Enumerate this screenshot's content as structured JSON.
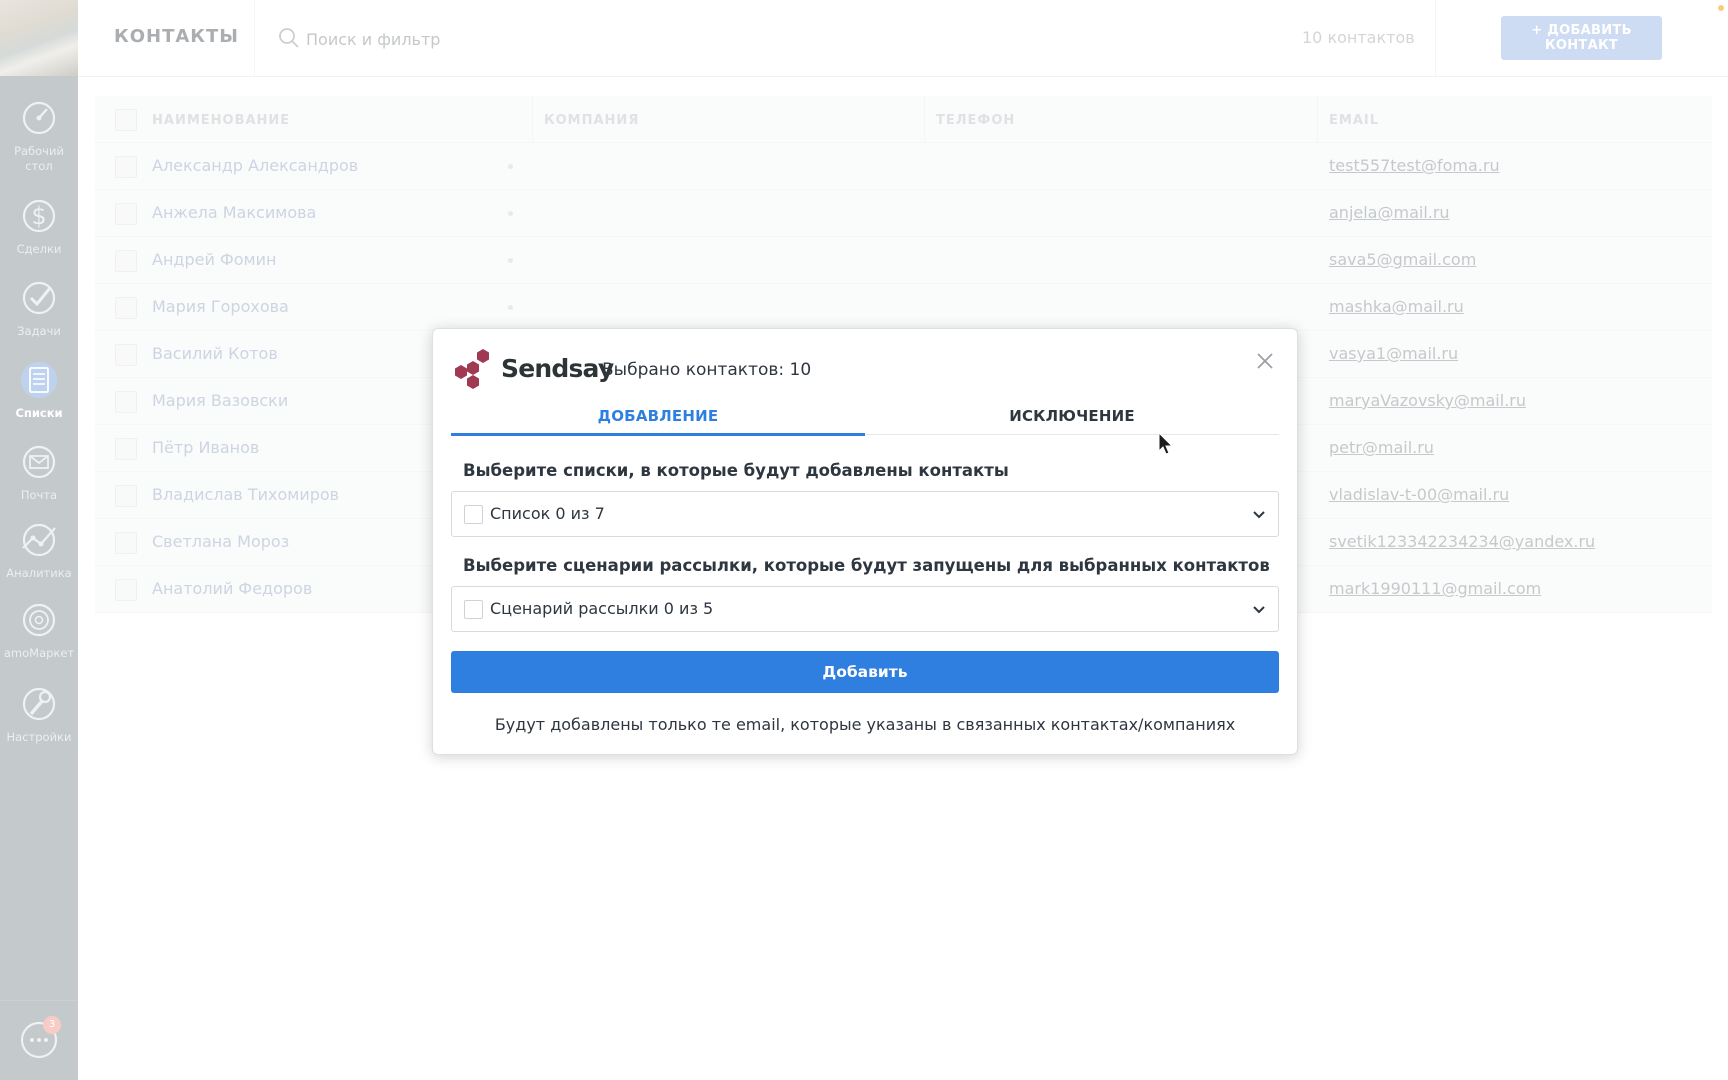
{
  "sidebar": {
    "items": [
      {
        "label_1": "Рабочий",
        "label_2": "стол",
        "icon": "dashboard-icon"
      },
      {
        "label": "Сделки",
        "icon": "dollar-icon"
      },
      {
        "label": "Задачи",
        "icon": "checkmark-icon"
      },
      {
        "label": "Списки",
        "icon": "list-icon",
        "active": true
      },
      {
        "label": "Почта",
        "icon": "mail-icon"
      },
      {
        "label": "Аналитика",
        "icon": "analytics-icon"
      },
      {
        "label": "amoМаркет",
        "icon": "market-icon"
      },
      {
        "label": "Настройки",
        "icon": "wrench-icon"
      }
    ],
    "chat_badge": "3"
  },
  "header": {
    "title": "КОНТАКТЫ",
    "search_placeholder": "Поиск и фильтр",
    "count": "10 контактов",
    "more": "···",
    "add_button": "+ ДОБАВИТЬ КОНТАКТ"
  },
  "table": {
    "columns": [
      "НАИМЕНОВАНИЕ",
      "КОМПАНИЯ",
      "ТЕЛЕФОН",
      "EMAIL"
    ],
    "rows": [
      {
        "name": "Александр Александров",
        "email": "test557test@foma.ru"
      },
      {
        "name": "Анжела Максимова",
        "email": "anjela@mail.ru"
      },
      {
        "name": "Андрей Фомин",
        "email": "sava5@gmail.com"
      },
      {
        "name": "Мария Горохова",
        "email": "mashka@mail.ru"
      },
      {
        "name": "Василий Котов",
        "email": "vasya1@mail.ru"
      },
      {
        "name": "Мария Вазовски",
        "email": "maryaVazovsky@mail.ru"
      },
      {
        "name": "Пётр Иванов",
        "email": "petr@mail.ru"
      },
      {
        "name": "Владислав Тихомиров",
        "email": "vladislav-t-00@mail.ru"
      },
      {
        "name": "Светлана Мороз",
        "email": "svetik123342234234@yandex.ru"
      },
      {
        "name": "Анатолий Федоров",
        "email": "mark1990111@gmail.com"
      }
    ]
  },
  "modal": {
    "logo_text": "Sendsay",
    "selected_count": "Выбрано контактов: 10",
    "tabs": [
      "ДОБАВЛЕНИЕ",
      "ИСКЛЮЧЕНИЕ"
    ],
    "lists_label": "Выберите списки, в которые будут добавлены контакты",
    "lists_select": "Список  0 из 7",
    "scenarios_label": "Выберите сценарии рассылки, которые будут запущены для выбранных контактов",
    "scenarios_select": "Сценарий рассылки  0 из 5",
    "primary_button": "Добавить",
    "note": "Будут добавлены только те email, которые указаны в связанных контактах/компаниях"
  },
  "colors": {
    "accent": "#2f7fe0",
    "sidebar": "#9aa2a8",
    "logo": "#a03a52"
  }
}
